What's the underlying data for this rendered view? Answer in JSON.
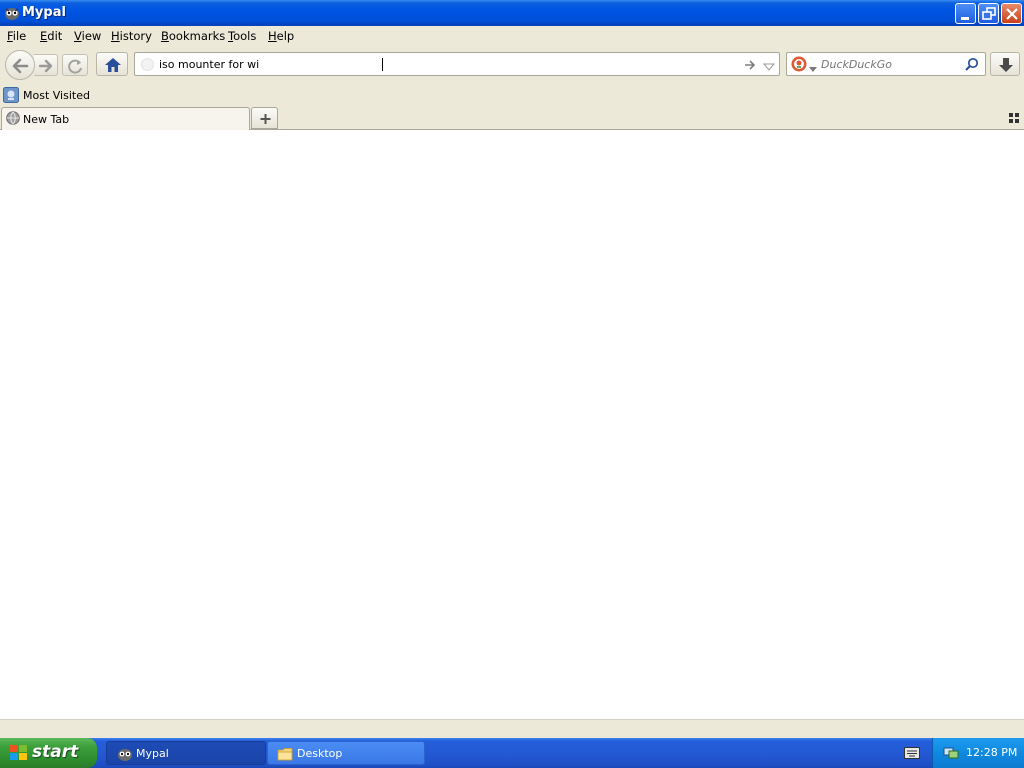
{
  "window": {
    "title": "Mypal",
    "controls": {
      "minimize": "minimize",
      "restore": "restore",
      "close": "close"
    }
  },
  "menubar": {
    "items": [
      {
        "label": "File",
        "access": "F",
        "rest": "ile"
      },
      {
        "label": "Edit",
        "access": "E",
        "rest": "dit"
      },
      {
        "label": "View",
        "access": "V",
        "rest": "iew"
      },
      {
        "label": "History",
        "access": "H",
        "rest": "istory"
      },
      {
        "label": "Bookmarks",
        "access": "B",
        "rest": "ookmarks"
      },
      {
        "label": "Tools",
        "access": "T",
        "rest": "ools"
      },
      {
        "label": "Help",
        "access": "H",
        "rest": "elp"
      }
    ]
  },
  "navbar": {
    "url_value": "iso mounter for wi",
    "search_placeholder": "DuckDuckGo"
  },
  "bookmarks": {
    "items": [
      {
        "label": "Most Visited"
      }
    ]
  },
  "tabs": {
    "items": [
      {
        "label": "New Tab"
      }
    ]
  },
  "taskbar": {
    "start_label": "start",
    "tasks": [
      {
        "label": "Mypal",
        "state": "active"
      },
      {
        "label": "Desktop",
        "state": "inactive"
      }
    ],
    "clock": "12:28 PM"
  },
  "colors": {
    "titlebar": "#0054e3",
    "taskbar": "#245edb",
    "start": "#3b9f3a",
    "tray": "#0f8ae0",
    "chrome": "#ece9d8"
  }
}
